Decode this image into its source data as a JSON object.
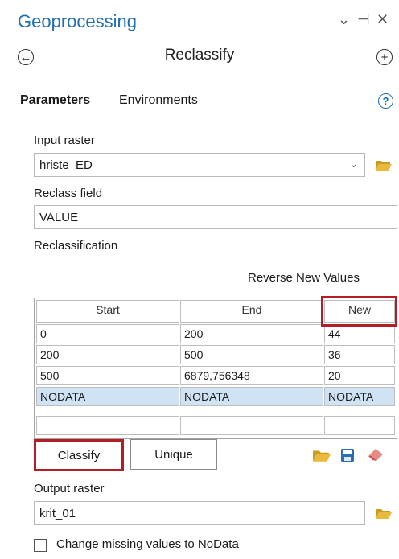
{
  "header": {
    "title": "Geoprocessing",
    "controls": [
      "⌄",
      "⊣",
      "✕"
    ]
  },
  "tool": {
    "name": "Reclassify"
  },
  "tabs": [
    {
      "label": "Parameters",
      "active": true
    },
    {
      "label": "Environments",
      "active": false
    }
  ],
  "params": {
    "input_raster_label": "Input raster",
    "input_raster_value": "hriste_ED",
    "reclass_field_label": "Reclass field",
    "reclass_field_value": "VALUE",
    "reclassification_label": "Reclassification",
    "reverse_label": "Reverse New Values",
    "columns": [
      "Start",
      "End",
      "New"
    ],
    "rows": [
      [
        "0",
        "200",
        "44"
      ],
      [
        "200",
        "500",
        "36"
      ],
      [
        "500",
        "6879,756348",
        "20"
      ],
      [
        "NODATA",
        "NODATA",
        "NODATA"
      ],
      [
        "",
        "",
        ""
      ]
    ],
    "classify_label": "Classify",
    "unique_label": "Unique",
    "output_raster_label": "Output raster",
    "output_raster_value": "krit_01",
    "missing_label": "Change missing values to NoData"
  },
  "colors": {
    "accent": "#1f6fb2",
    "highlight": "#b21e24",
    "nodata_row": "#cfe3f5",
    "folder": "#e8b93a"
  }
}
